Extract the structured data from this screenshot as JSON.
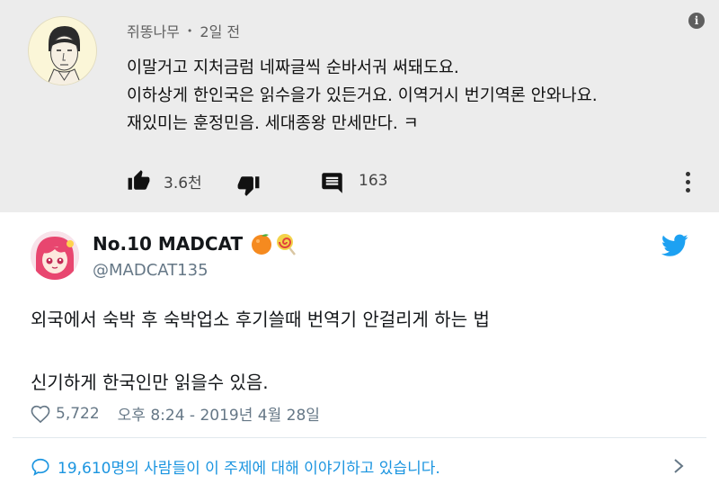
{
  "comment": {
    "author": "쥐똥나무",
    "separator": "•",
    "time": "2일 전",
    "lines": [
      "이말거고 지처금럼 네짜글씩 순바서궈 써돼도요.",
      "이하상게 한인국은 읽수을가 있든거요. 이역거시 번기역론 안와나요.",
      "재있미는 훈정민음. 세대종왕 만세만다. ㅋ"
    ],
    "likes": "3.6천",
    "replies": "163",
    "info_icon": "i",
    "icons": [
      "info-icon",
      "thumbs-up-icon",
      "thumbs-down-icon",
      "comment-icon",
      "more-vert-icon"
    ]
  },
  "tweet": {
    "display_name": "No.10 MADCAT",
    "handle": "@MADCAT135",
    "name_emojis": [
      "orange-emoji",
      "lollipop-emoji"
    ],
    "text_line1": "외국에서 숙박 후 숙박업소 후기쓸때 번역기 안걸리게 하는 법",
    "text_line2": "신기하게 한국인만 읽을수 있음.",
    "likes": "5,722",
    "timestamp": "오후 8:24 - 2019년 4월 28일",
    "conversation": "19,610명의 사람들이 이 주제에 대해 이야기하고 있습니다.",
    "colors": {
      "link": "#1b95e0",
      "twitter_blue": "#1da1f2",
      "muted": "#657786"
    }
  }
}
